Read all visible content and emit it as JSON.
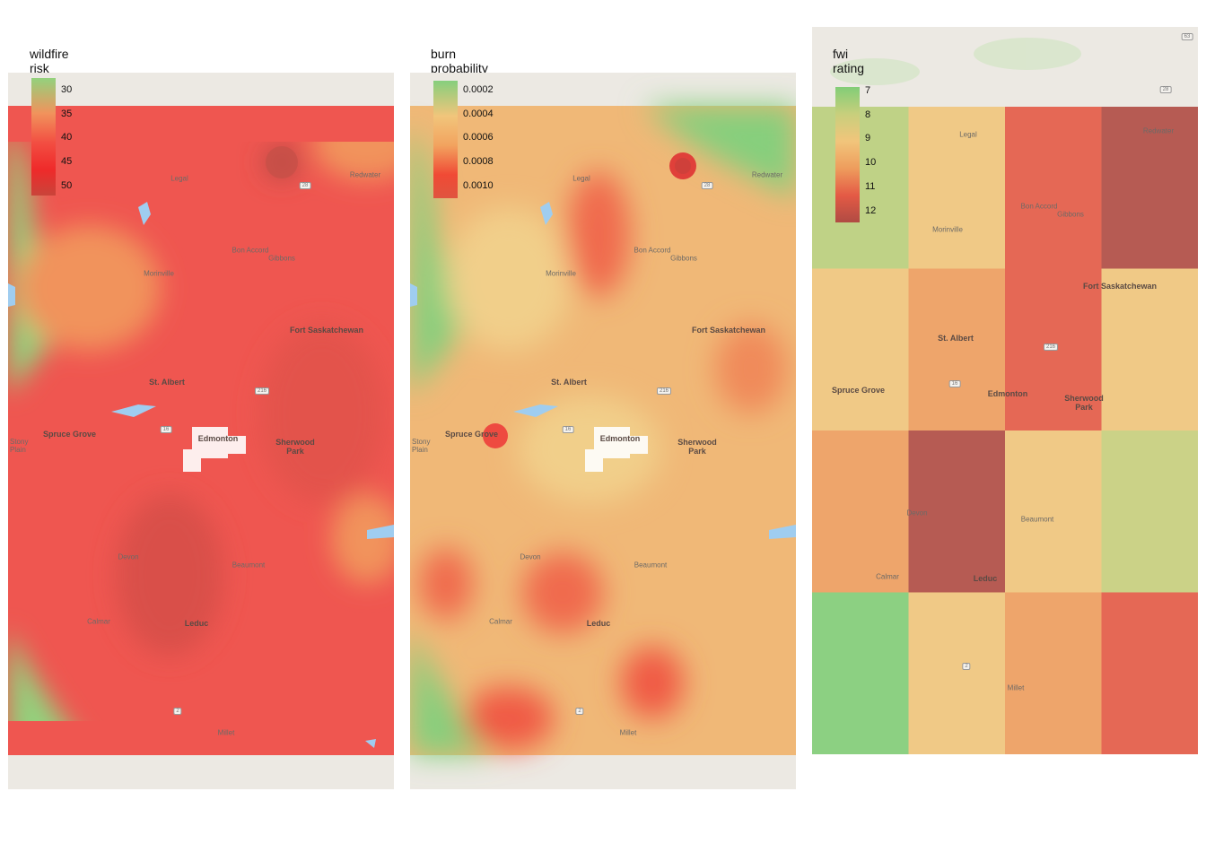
{
  "panels": [
    {
      "title": "wildfire risk rating",
      "legend_labels": [
        "30",
        "35",
        "40",
        "45",
        "50"
      ],
      "legend_colors": [
        "#93d27d",
        "#f1935c",
        "#f24e42",
        "#ef2a2a",
        "#c9443a"
      ]
    },
    {
      "title": "burn probability",
      "legend_labels": [
        "0.0002",
        "0.0004",
        "0.0006",
        "0.0008",
        "0.0010"
      ],
      "legend_colors": [
        "#86cf7d",
        "#f1c57b",
        "#f2a35f",
        "#f04a35",
        "#e0553f"
      ]
    },
    {
      "title": "fwi rating",
      "legend_labels": [
        "7",
        "8",
        "9",
        "10",
        "11",
        "12"
      ],
      "legend_colors": [
        "#82cd77",
        "#c8cf7c",
        "#f1c57b",
        "#ee9d5d",
        "#e45a45",
        "#b04b43"
      ]
    }
  ],
  "towns": {
    "legal": "Legal",
    "redwater": "Redwater",
    "bon_accord": "Bon Accord",
    "gibbons": "Gibbons",
    "morinville": "Morinville",
    "fort_sask": "Fort Saskatchewan",
    "st_albert": "St. Albert",
    "spruce_grove": "Spruce Grove",
    "stony_plain": "Stony Plain",
    "edmonton": "Edmonton",
    "sherwood_park": "Sherwood Park",
    "devon": "Devon",
    "beaumont": "Beaumont",
    "calmar": "Calmar",
    "leduc": "Leduc",
    "millet": "Millet"
  },
  "highways": {
    "h28": "28",
    "h16": "16",
    "h216": "216",
    "h2": "2",
    "h63": "63",
    "h628": "628"
  },
  "fwi_grid": [
    [
      7.8,
      9.0,
      11.0,
      12.0
    ],
    [
      9.0,
      10.0,
      11.0,
      9.0
    ],
    [
      10.0,
      12.0,
      9.0,
      8.0
    ],
    [
      7.0,
      9.0,
      10.0,
      11.0
    ]
  ]
}
